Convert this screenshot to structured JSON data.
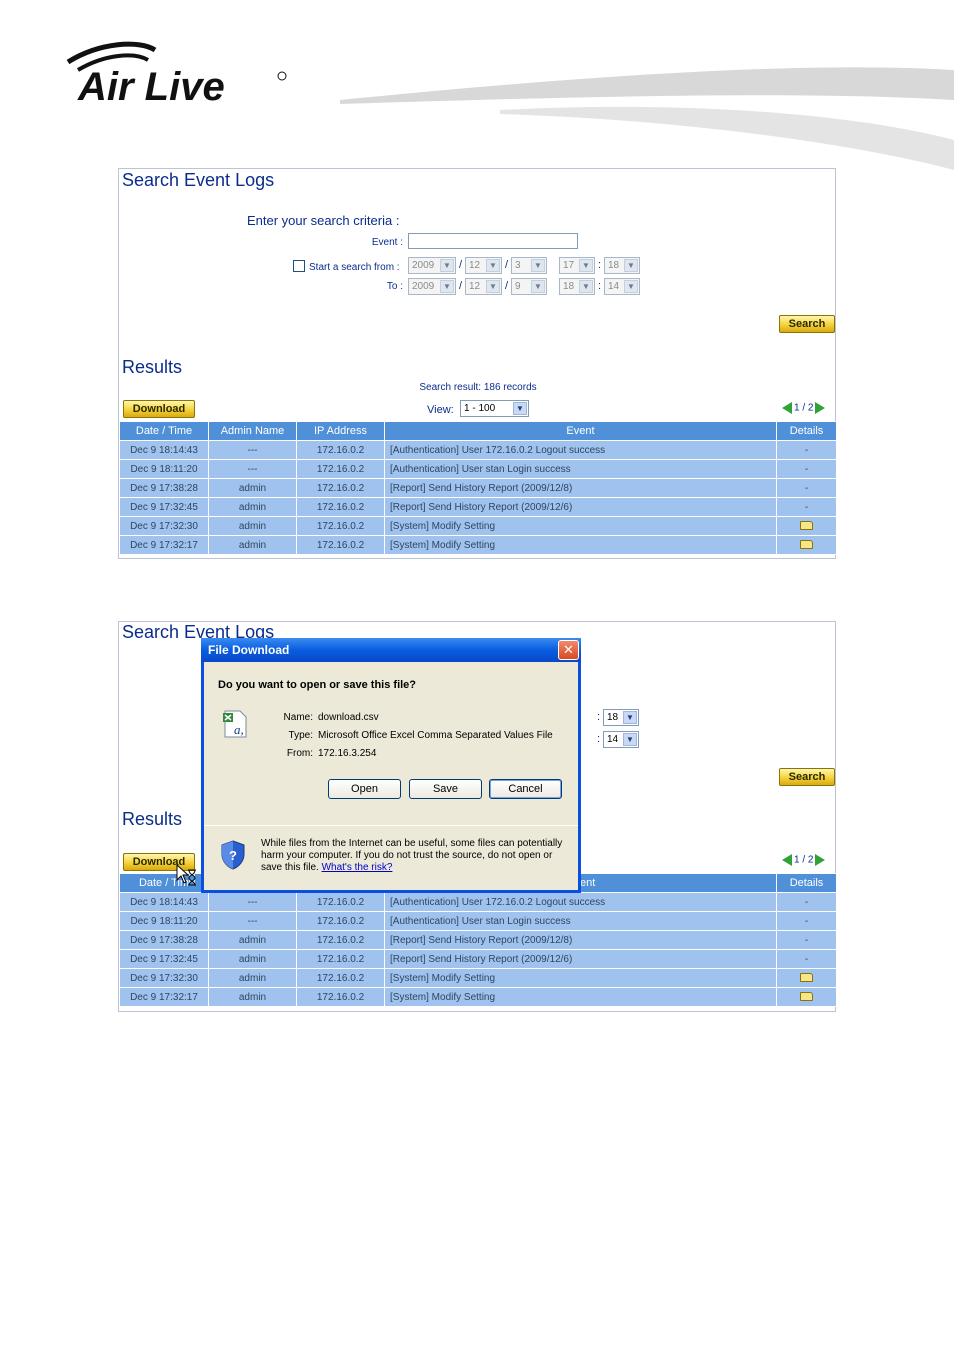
{
  "brand": {
    "logo_text": "Air Live"
  },
  "panel1": {
    "title": "Search Event Logs",
    "criteria_heading": "Enter your search criteria :",
    "event_label": "Event :",
    "event_value": "",
    "start_label": "Start a search from :",
    "to_label": "To :",
    "from": {
      "year": "2009",
      "month": "12",
      "day": "3",
      "hour": "17",
      "minute": "18"
    },
    "to": {
      "year": "2009",
      "month": "12",
      "day": "9",
      "hour": "18",
      "minute": "14"
    },
    "search_button": "Search",
    "results_title": "Results",
    "result_count": "Search result: 186 records",
    "download_button": "Download",
    "view_label": "View:",
    "view_value": "1 - 100",
    "pager": "1 / 2"
  },
  "table": {
    "headers": [
      "Date / Time",
      "Admin Name",
      "IP Address",
      "Event",
      "Details"
    ],
    "rows": [
      {
        "time": "Dec 9 18:14:43",
        "admin": "---",
        "ip": "172.16.0.2",
        "event": "[Authentication] User 172.16.0.2 Logout success",
        "details": "-"
      },
      {
        "time": "Dec 9 18:11:20",
        "admin": "---",
        "ip": "172.16.0.2",
        "event": "[Authentication] User stan Login success",
        "details": "-"
      },
      {
        "time": "Dec 9 17:38:28",
        "admin": "admin",
        "ip": "172.16.0.2",
        "event": "[Report] Send History Report (2009/12/8)",
        "details": "-"
      },
      {
        "time": "Dec 9 17:32:45",
        "admin": "admin",
        "ip": "172.16.0.2",
        "event": "[Report] Send History Report (2009/12/6)",
        "details": "-"
      },
      {
        "time": "Dec 9 17:32:30",
        "admin": "admin",
        "ip": "172.16.0.2",
        "event": "[System] Modify Setting",
        "details": "folder-icon"
      },
      {
        "time": "Dec 9 17:32:17",
        "admin": "admin",
        "ip": "172.16.0.2",
        "event": "[System] Modify Setting",
        "details": "folder-icon"
      }
    ]
  },
  "panel2": {
    "title": "Search Event Logs",
    "hour": "18",
    "minute": "14",
    "search_button": "Search",
    "results_title": "Results",
    "download_button": "Download",
    "pager": "1 / 2",
    "header_date_partial": "Date / Tim",
    "header_event_partial": "ent",
    "header_details": "Details"
  },
  "dialog": {
    "title": "File Download",
    "close": "✕",
    "question": "Do you want to open or save this file?",
    "name_label": "Name:",
    "name_value": "download.csv",
    "type_label": "Type:",
    "type_value": "Microsoft Office Excel Comma Separated Values File",
    "from_label": "From:",
    "from_value": "172.16.3.254",
    "open_button": "Open",
    "save_button": "Save",
    "cancel_button": "Cancel",
    "warning_text": "While files from the Internet can be useful, some files can potentially harm your computer. If you do not trust the source, do not open or save this file.",
    "risk_link": "What's the risk?"
  }
}
